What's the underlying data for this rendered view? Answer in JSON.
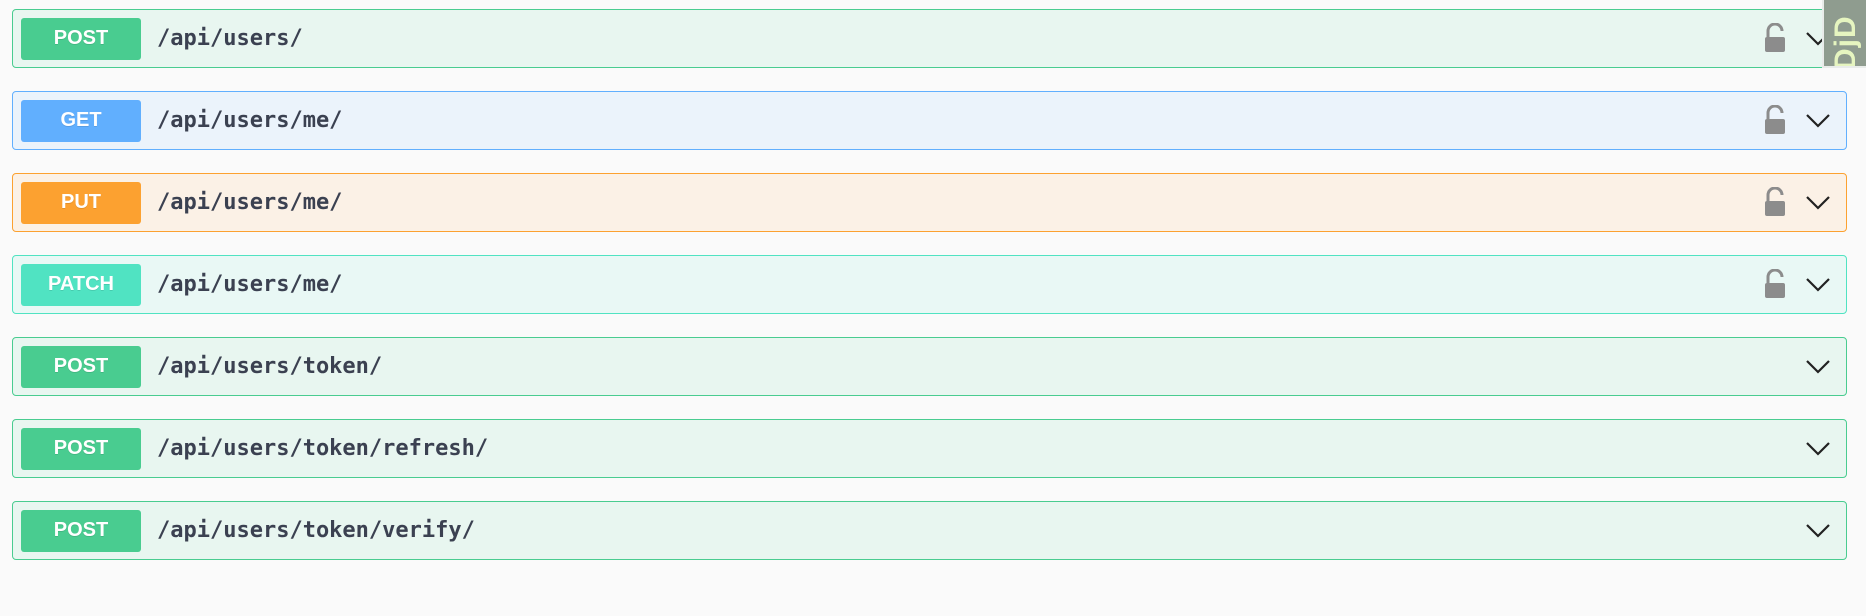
{
  "operations": [
    {
      "method": "POST",
      "path": "/api/users/",
      "kind": "post",
      "locked": true
    },
    {
      "method": "GET",
      "path": "/api/users/me/",
      "kind": "get",
      "locked": true
    },
    {
      "method": "PUT",
      "path": "/api/users/me/",
      "kind": "put",
      "locked": true
    },
    {
      "method": "PATCH",
      "path": "/api/users/me/",
      "kind": "patch",
      "locked": true
    },
    {
      "method": "POST",
      "path": "/api/users/token/",
      "kind": "post",
      "locked": false
    },
    {
      "method": "POST",
      "path": "/api/users/token/refresh/",
      "kind": "post",
      "locked": false
    },
    {
      "method": "POST",
      "path": "/api/users/token/verify/",
      "kind": "post",
      "locked": false
    }
  ],
  "icons": {
    "lock": "unlocked-padlock-icon",
    "expand": "chevron-down-icon"
  },
  "colors": {
    "post": "#49cc90",
    "get": "#61affe",
    "put": "#fca130",
    "patch": "#50e3c2",
    "path_text": "#3b4151",
    "lock": "#8c8c8c"
  },
  "corner_widget": {
    "text": "DjD"
  }
}
